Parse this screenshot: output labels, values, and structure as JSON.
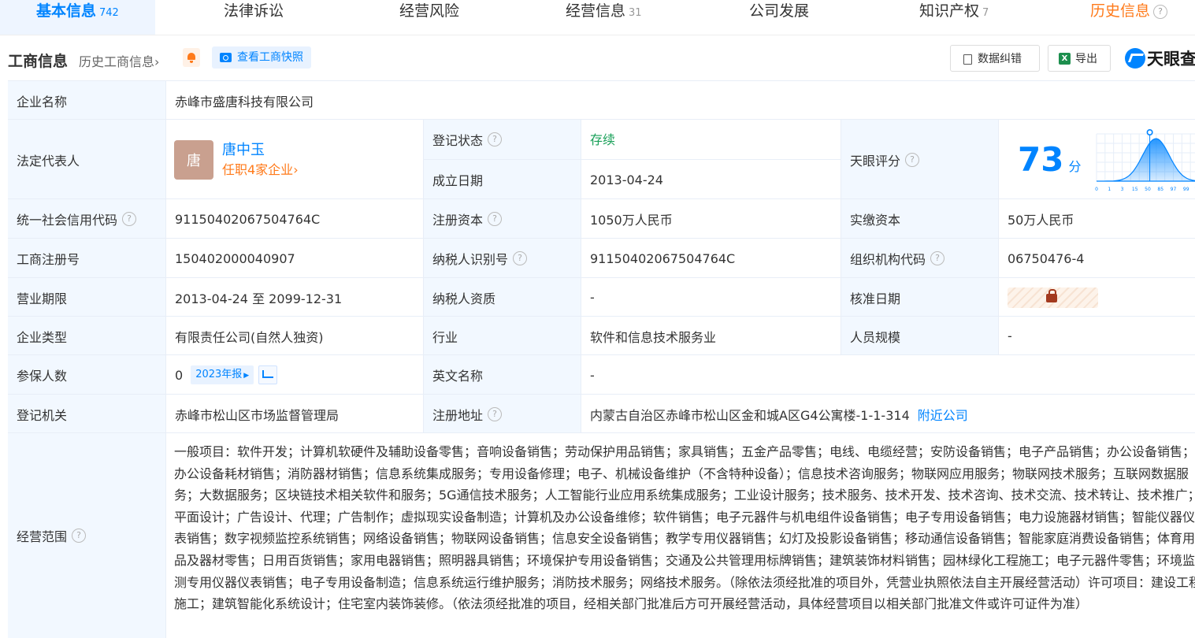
{
  "tabs": [
    {
      "label": "基本信息",
      "count": "742"
    },
    {
      "label": "法律诉讼",
      "count": ""
    },
    {
      "label": "经营风险",
      "count": ""
    },
    {
      "label": "经营信息",
      "count": "31"
    },
    {
      "label": "公司发展",
      "count": ""
    },
    {
      "label": "知识产权",
      "count": "7"
    },
    {
      "label": "历史信息",
      "count": ""
    }
  ],
  "toolbar": {
    "title": "工商信息",
    "history_link": "历史工商信息",
    "snapshot_button": "查看工商快照",
    "correct_button": "数据纠错",
    "export_button": "导出",
    "brand": "天眼查"
  },
  "company": {
    "name_label": "企业名称",
    "name": "赤峰市盛唐科技有限公司",
    "legal_rep_label": "法定代表人",
    "legal_rep_avatar": "唐",
    "legal_rep_name": "唐中玉",
    "legal_rep_sub": "任职4家企业",
    "status_label": "登记状态",
    "status": "存续",
    "founded_label": "成立日期",
    "founded": "2013-04-24",
    "score_label": "天眼评分",
    "score": "73",
    "score_unit": "分",
    "credit_code_label": "统一社会信用代码",
    "credit_code": "91150402067504764C",
    "reg_capital_label": "注册资本",
    "reg_capital": "1050万人民币",
    "paid_capital_label": "实缴资本",
    "paid_capital": "50万人民币",
    "reg_no_label": "工商注册号",
    "reg_no": "150402000040907",
    "taxpayer_id_label": "纳税人识别号",
    "taxpayer_id": "91150402067504764C",
    "org_code_label": "组织机构代码",
    "org_code": "06750476-4",
    "term_label": "营业期限",
    "term": "2013-04-24 至 2099-12-31",
    "taxpayer_qual_label": "纳税人资质",
    "taxpayer_qual": "-",
    "approve_date_label": "核准日期",
    "type_label": "企业类型",
    "type": "有限责任公司(自然人独资)",
    "industry_label": "行业",
    "industry": "软件和信息技术服务业",
    "staff_label": "人员规模",
    "staff": "-",
    "insured_label": "参保人数",
    "insured": "0",
    "insured_badge": "2023年报",
    "english_name_label": "英文名称",
    "english_name": "-",
    "authority_label": "登记机关",
    "authority": "赤峰市松山区市场监督管理局",
    "address_label": "注册地址",
    "address": "内蒙古自治区赤峰市松山区金和城A区G4公寓楼-1-1-314",
    "nearby_link": "附近公司",
    "scope_label": "经营范围",
    "scope": "一般项目：软件开发；计算机软硬件及辅助设备零售；音响设备销售；劳动保护用品销售；家具销售；五金产品零售；电线、电缆经营；安防设备销售；电子产品销售；办公设备销售；办公设备耗材销售；消防器材销售；信息系统集成服务；专用设备修理；电子、机械设备维护（不含特种设备）；信息技术咨询服务；物联网应用服务；物联网技术服务；互联网数据服务；大数据服务；区块链技术相关软件和服务；5G通信技术服务；人工智能行业应用系统集成服务；工业设计服务；技术服务、技术开发、技术咨询、技术交流、技术转让、技术推广；平面设计；广告设计、代理；广告制作；虚拟现实设备制造；计算机及办公设备维修；软件销售；电子元器件与机电组件设备销售；电子专用设备销售；电力设施器材销售；智能仪器仪表销售；数字视频监控系统销售；网络设备销售；物联网设备销售；信息安全设备销售；教学专用仪器销售；幻灯及投影设备销售；移动通信设备销售；智能家庭消费设备销售；体育用品及器材零售；日用百货销售；家用电器销售；照明器具销售；环境保护专用设备销售；交通及公共管理用标牌销售；建筑装饰材料销售；园林绿化工程施工；电子元器件零售；环境监测专用仪器仪表销售；电子专用设备制造；信息系统运行维护服务；消防技术服务；网络技术服务。（除依法须经批准的项目外，凭营业执照依法自主开展经营活动）许可项目：建设工程施工；建筑智能化系统设计；住宅室内装饰装修。（依法须经批准的项目，经相关部门批准后方可开展经营活动，具体经营项目以相关部门批准文件或许可证件为准）"
  },
  "score_chart": {
    "ticks": [
      "0",
      "1",
      "3",
      "15",
      "50",
      "85",
      "97",
      "99",
      "100"
    ],
    "marker": 73
  },
  "colors": {
    "accent": "#0084ff",
    "label_bg": "#f2f8ff",
    "status_green": "#18a058",
    "orange": "#ff7a1a"
  }
}
